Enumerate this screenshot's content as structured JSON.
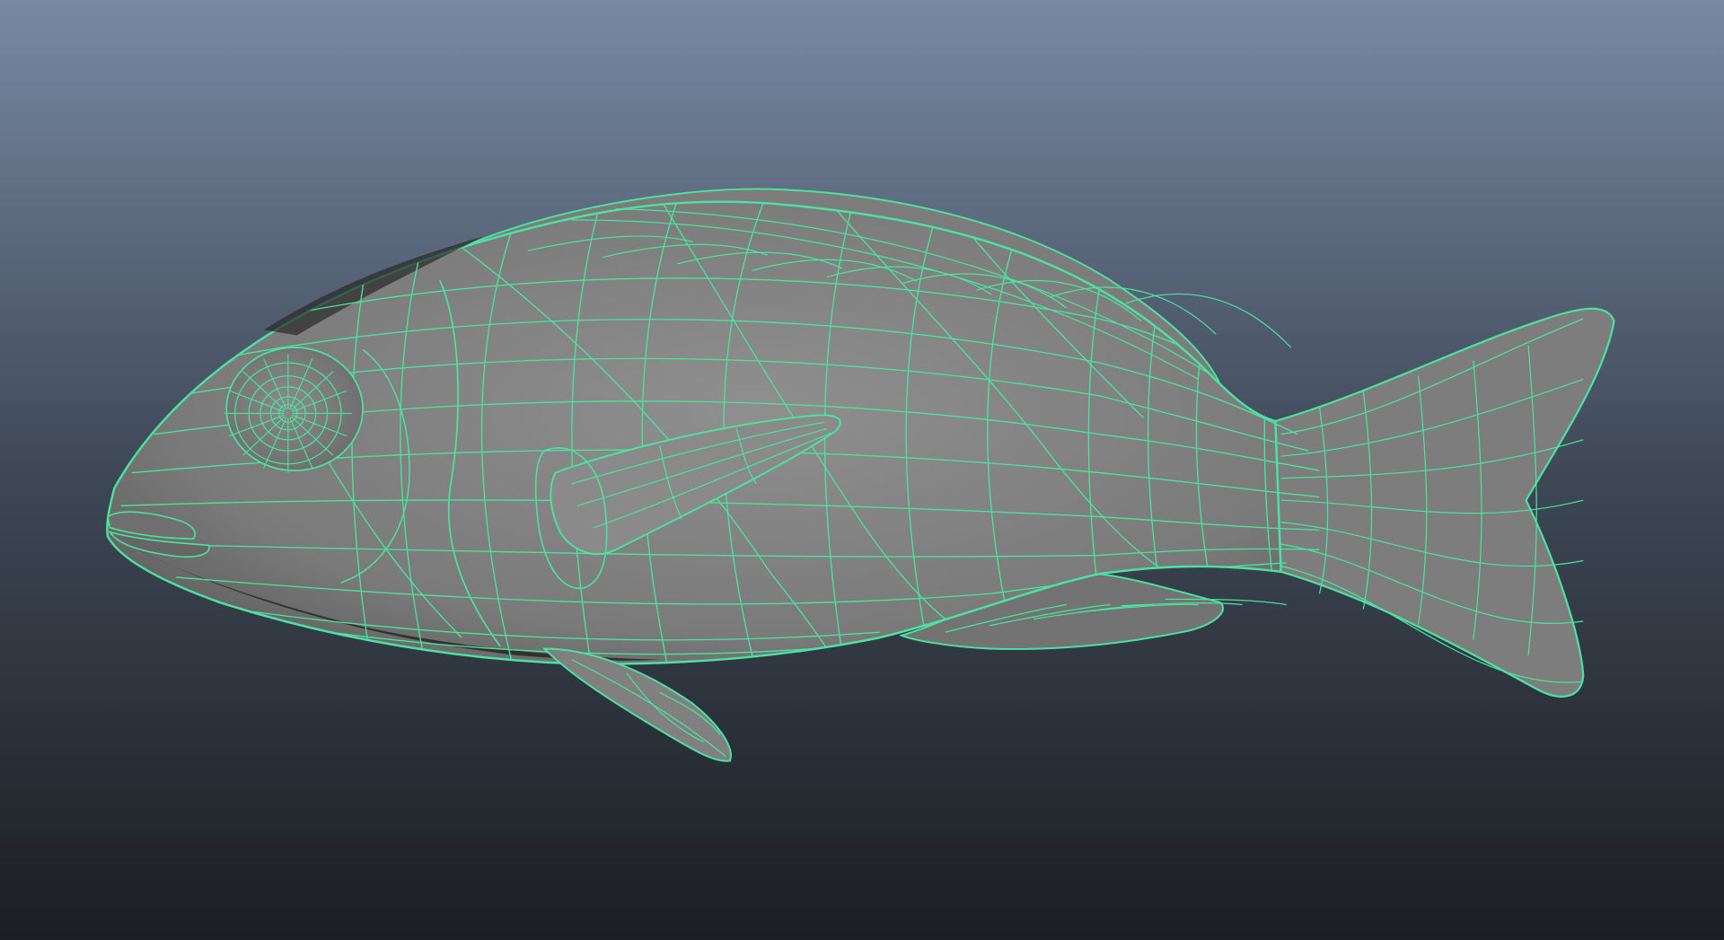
{
  "viewport": {
    "background_top": "#7889a3",
    "background_middle": "#3e4856",
    "background_bottom": "#1b1e22"
  },
  "model": {
    "subject": "fish-mesh",
    "display_mode": "shaded-with-wireframe-on-shaded",
    "selected": true,
    "shade_color": "#7a7a7a",
    "shade_highlight": "#8f8f8f",
    "shade_dark": "#2a2a2a",
    "wireframe_color": "#4be3a0"
  }
}
